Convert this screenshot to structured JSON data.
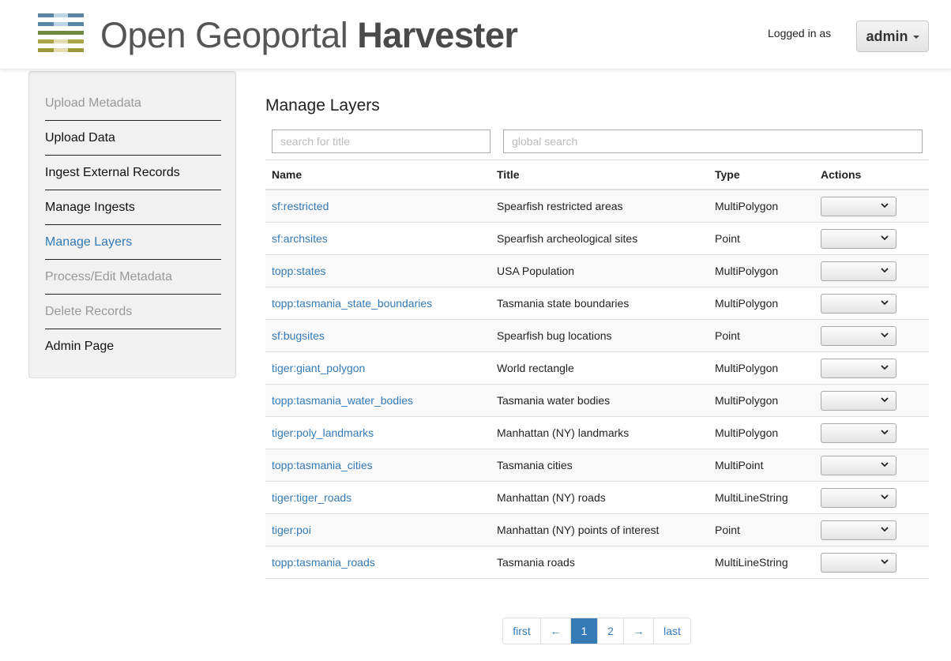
{
  "header": {
    "logo_light": "Open Geoportal",
    "logo_bold": "Harvester",
    "logged_in_label": "Logged in as",
    "user": "admin"
  },
  "sidebar": {
    "items": [
      {
        "label": "Upload Metadata",
        "state": "disabled"
      },
      {
        "label": "Upload Data",
        "state": "normal"
      },
      {
        "label": "Ingest External Records",
        "state": "normal"
      },
      {
        "label": "Manage Ingests",
        "state": "normal"
      },
      {
        "label": "Manage Layers",
        "state": "active"
      },
      {
        "label": "Process/Edit Metadata",
        "state": "disabled"
      },
      {
        "label": "Delete Records",
        "state": "disabled"
      },
      {
        "label": "Admin Page",
        "state": "normal"
      }
    ]
  },
  "main": {
    "title": "Manage Layers",
    "search_title_placeholder": "search for title",
    "global_search_placeholder": "global search",
    "columns": [
      "Name",
      "Title",
      "Type",
      "Actions"
    ],
    "rows": [
      {
        "name": "sf:restricted",
        "title": "Spearfish restricted areas",
        "type": "MultiPolygon"
      },
      {
        "name": "sf:archsites",
        "title": "Spearfish archeological sites",
        "type": "Point"
      },
      {
        "name": "topp:states",
        "title": "USA Population",
        "type": "MultiPolygon"
      },
      {
        "name": "topp:tasmania_state_boundaries",
        "title": "Tasmania state boundaries",
        "type": "MultiPolygon"
      },
      {
        "name": "sf:bugsites",
        "title": "Spearfish bug locations",
        "type": "Point"
      },
      {
        "name": "tiger:giant_polygon",
        "title": "World rectangle",
        "type": "MultiPolygon"
      },
      {
        "name": "topp:tasmania_water_bodies",
        "title": "Tasmania water bodies",
        "type": "MultiPolygon"
      },
      {
        "name": "tiger:poly_landmarks",
        "title": "Manhattan (NY) landmarks",
        "type": "MultiPolygon"
      },
      {
        "name": "topp:tasmania_cities",
        "title": "Tasmania cities",
        "type": "MultiPoint"
      },
      {
        "name": "tiger:tiger_roads",
        "title": "Manhattan (NY) roads",
        "type": "MultiLineString"
      },
      {
        "name": "tiger:poi",
        "title": "Manhattan (NY) points of interest",
        "type": "Point"
      },
      {
        "name": "topp:tasmania_roads",
        "title": "Tasmania roads",
        "type": "MultiLineString"
      }
    ]
  },
  "pagination": {
    "items": [
      {
        "label": "first",
        "active": false
      },
      {
        "label": "←",
        "active": false
      },
      {
        "label": "1",
        "active": true
      },
      {
        "label": "2",
        "active": false
      },
      {
        "label": "→",
        "active": false
      },
      {
        "label": "last",
        "active": false
      }
    ]
  },
  "colors": {
    "link": "#337ab7",
    "logo_stripes": [
      "#5b86a3",
      "#bcd6e6",
      "#6f8a3e",
      "#a9a548",
      "#e2dcb0",
      "#9c9a3a"
    ]
  }
}
